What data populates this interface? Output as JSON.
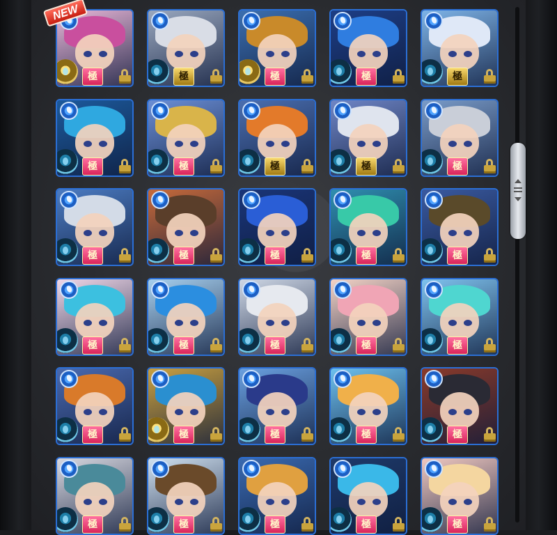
{
  "new_badge": "NEW",
  "colors": {
    "frame_blue": "#2b6fd6",
    "lock_gold": "#c9a43c",
    "kyoku_pink": "#d9245a",
    "kyoku_gold": "#a27b12"
  },
  "icons": {
    "element": "water-droplet-icon",
    "lock": "lock-icon",
    "scroll": "scroll-thumb"
  },
  "monsters": [
    {
      "kyoku": "極",
      "kyoku_style": "pink",
      "orb": "gold",
      "hair": "#c94f9e",
      "bg": "#e9b7d8"
    },
    {
      "kyoku": "極",
      "kyoku_style": "gold",
      "orb": "blue",
      "hair": "#d9dde6",
      "bg": "#9aa8bf"
    },
    {
      "kyoku": "極",
      "kyoku_style": "pink",
      "orb": "gold",
      "hair": "#c98a2a",
      "bg": "#3b6fb0"
    },
    {
      "kyoku": "極",
      "kyoku_style": "pink",
      "orb": "blue",
      "hair": "#2f7de0",
      "bg": "#1d3e86"
    },
    {
      "kyoku": "極",
      "kyoku_style": "gold",
      "orb": "blue",
      "hair": "#dfe8f7",
      "bg": "#7eb4e8"
    },
    {
      "kyoku": "極",
      "kyoku_style": "pink",
      "orb": "blue",
      "hair": "#2fa8e0",
      "bg": "#1c5a9c"
    },
    {
      "kyoku": "極",
      "kyoku_style": "pink",
      "orb": "blue",
      "hair": "#d9b44a",
      "bg": "#6b8fd6"
    },
    {
      "kyoku": "極",
      "kyoku_style": "gold",
      "orb": "blue",
      "hair": "#e37a2a",
      "bg": "#4b6fb0"
    },
    {
      "kyoku": "極",
      "kyoku_style": "gold",
      "orb": "blue",
      "hair": "#dfe4ee",
      "bg": "#6f86c6"
    },
    {
      "kyoku": "極",
      "kyoku_style": "pink",
      "orb": "blue",
      "hair": "#c9ced8",
      "bg": "#7a9cc9"
    },
    {
      "kyoku": "極",
      "kyoku_style": "pink",
      "orb": "blue",
      "hair": "#d3dbe7",
      "bg": "#4c7cc2"
    },
    {
      "kyoku": "極",
      "kyoku_style": "pink",
      "orb": "blue",
      "hair": "#5a3e2a",
      "bg": "#c76a3a"
    },
    {
      "kyoku": "極",
      "kyoku_style": "pink",
      "orb": "blue",
      "hair": "#2a5ed6",
      "bg": "#1a3578"
    },
    {
      "kyoku": "極",
      "kyoku_style": "pink",
      "orb": "blue",
      "hair": "#38c9a8",
      "bg": "#2f8fb0"
    },
    {
      "kyoku": "極",
      "kyoku_style": "pink",
      "orb": "blue",
      "hair": "#5a4a2a",
      "bg": "#3a5aa0"
    },
    {
      "kyoku": "極",
      "kyoku_style": "pink",
      "orb": "blue",
      "hair": "#3cc0e0",
      "bg": "#f0d7e8"
    },
    {
      "kyoku": "極",
      "kyoku_style": "pink",
      "orb": "blue",
      "hair": "#2b8ee0",
      "bg": "#a7d0ef"
    },
    {
      "kyoku": "極",
      "kyoku_style": "pink",
      "orb": "blue",
      "hair": "#e6e9ef",
      "bg": "#cfd8e6"
    },
    {
      "kyoku": "極",
      "kyoku_style": "pink",
      "orb": "blue",
      "hair": "#f0a5b5",
      "bg": "#f4d3c6"
    },
    {
      "kyoku": "極",
      "kyoku_style": "pink",
      "orb": "blue",
      "hair": "#4fd6d0",
      "bg": "#7fc3ef"
    },
    {
      "kyoku": "極",
      "kyoku_style": "pink",
      "orb": "blue",
      "hair": "#d97a2a",
      "bg": "#4a6ab0"
    },
    {
      "kyoku": "極",
      "kyoku_style": "pink",
      "orb": "gold",
      "hair": "#2a8fd0",
      "bg": "#c9a040"
    },
    {
      "kyoku": "極",
      "kyoku_style": "pink",
      "orb": "blue",
      "hair": "#2a3a8a",
      "bg": "#6aa0e0"
    },
    {
      "kyoku": "極",
      "kyoku_style": "pink",
      "orb": "blue",
      "hair": "#f0b04a",
      "bg": "#6cc0ef"
    },
    {
      "kyoku": "極",
      "kyoku_style": "pink",
      "orb": "blue",
      "hair": "#2a2a34",
      "bg": "#8a3a2a"
    },
    {
      "kyoku": "極",
      "kyoku_style": "pink",
      "orb": "blue",
      "hair": "#4a8a9a",
      "bg": "#d8d8e0"
    },
    {
      "kyoku": "極",
      "kyoku_style": "pink",
      "orb": "blue",
      "hair": "#6a4a2a",
      "bg": "#cfe0ef"
    },
    {
      "kyoku": "極",
      "kyoku_style": "pink",
      "orb": "blue",
      "hair": "#e0a040",
      "bg": "#3a6ab0"
    },
    {
      "kyoku": "極",
      "kyoku_style": "pink",
      "orb": "blue",
      "hair": "#3ab8e8",
      "bg": "#1e3a6a"
    },
    {
      "kyoku": "極",
      "kyoku_style": "pink",
      "orb": "blue",
      "hair": "#f4d6a0",
      "bg": "#f0c8c0"
    }
  ]
}
